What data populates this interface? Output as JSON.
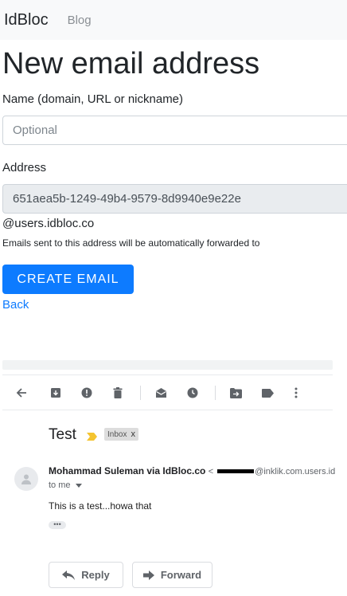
{
  "nav": {
    "brand": "IdBloc",
    "blog": "Blog"
  },
  "page": {
    "title": "New email address"
  },
  "form": {
    "name_label": "Name (domain, URL or nickname)",
    "name_placeholder": "Optional",
    "address_label": "Address",
    "address_value": "651aea5b-1249-49b4-9579-8d9940e9e22e",
    "domain_suffix": "@users.idbloc.co",
    "note": "Emails sent to this address will be automatically forwarded to",
    "create_label": "CREATE EMAIL",
    "back_label": "Back"
  },
  "email": {
    "subject": "Test",
    "label_badge": "Inbox",
    "badge_close": "x",
    "sender_name": "Mohammad Suleman via IdBloc.co",
    "sender_addr_prefix": "<",
    "sender_addr_suffix": "@inklik.com.users.id",
    "to_line": "to me",
    "body": "This is a test...howa that",
    "reply_label": "Reply",
    "forward_label": "Forward"
  },
  "colors": {
    "primary": "#0d7bff",
    "navbar": "#f8f9fa",
    "readonly_bg": "#e9ecef"
  }
}
